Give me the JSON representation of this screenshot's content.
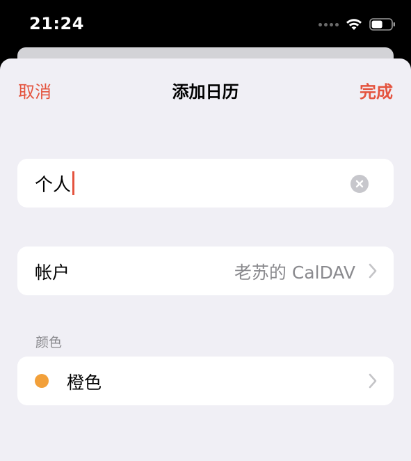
{
  "status_bar": {
    "time": "21:24"
  },
  "nav": {
    "cancel_label": "取消",
    "title": "添加日历",
    "done_label": "完成"
  },
  "name_field": {
    "value": "个人"
  },
  "account_row": {
    "label": "帐户",
    "value": "老苏的 CalDAV"
  },
  "color_section": {
    "header": "颜色",
    "color_name": "橙色",
    "color_hex": "#f2a03a"
  },
  "colors": {
    "accent": "#e4533e",
    "background": "#f0eff5",
    "secondary_text": "#8a8a8e"
  },
  "icons": {
    "wifi": "wifi-icon",
    "battery": "battery-icon",
    "clear": "clear-icon",
    "chevron": "chevron-right-icon"
  }
}
